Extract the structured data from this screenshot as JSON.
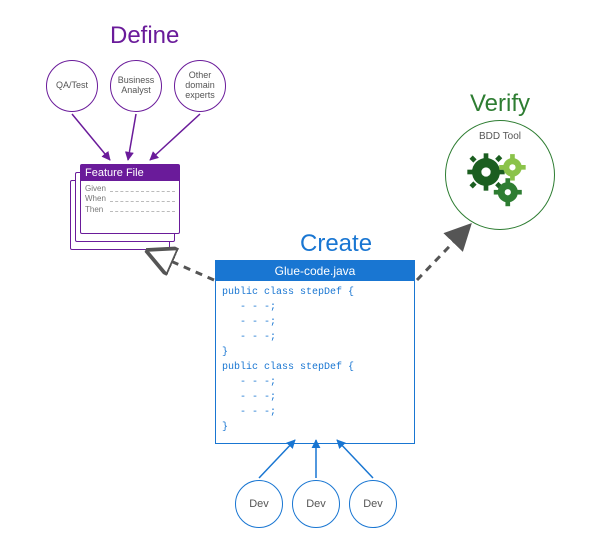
{
  "sections": {
    "define": {
      "title": "Define"
    },
    "create": {
      "title": "Create"
    },
    "verify": {
      "title": "Verify"
    }
  },
  "roles": {
    "qa": "QA/Test",
    "ba": "Business\nAnalyst",
    "other": "Other\ndomain\nexperts"
  },
  "feature_file": {
    "title": "Feature File",
    "keywords": [
      "Given",
      "When",
      "Then"
    ]
  },
  "glue_code": {
    "filename": "Glue-code.java",
    "lines": [
      "public class stepDef {",
      "   - - -;",
      "   - - -;",
      "   - - -;",
      "}",
      "public class stepDef {",
      "   - - -;",
      "   - - -;",
      "   - - -;",
      "}"
    ]
  },
  "devs": {
    "d1": "Dev",
    "d2": "Dev",
    "d3": "Dev"
  },
  "bdd": {
    "label": "BDD Tool"
  }
}
